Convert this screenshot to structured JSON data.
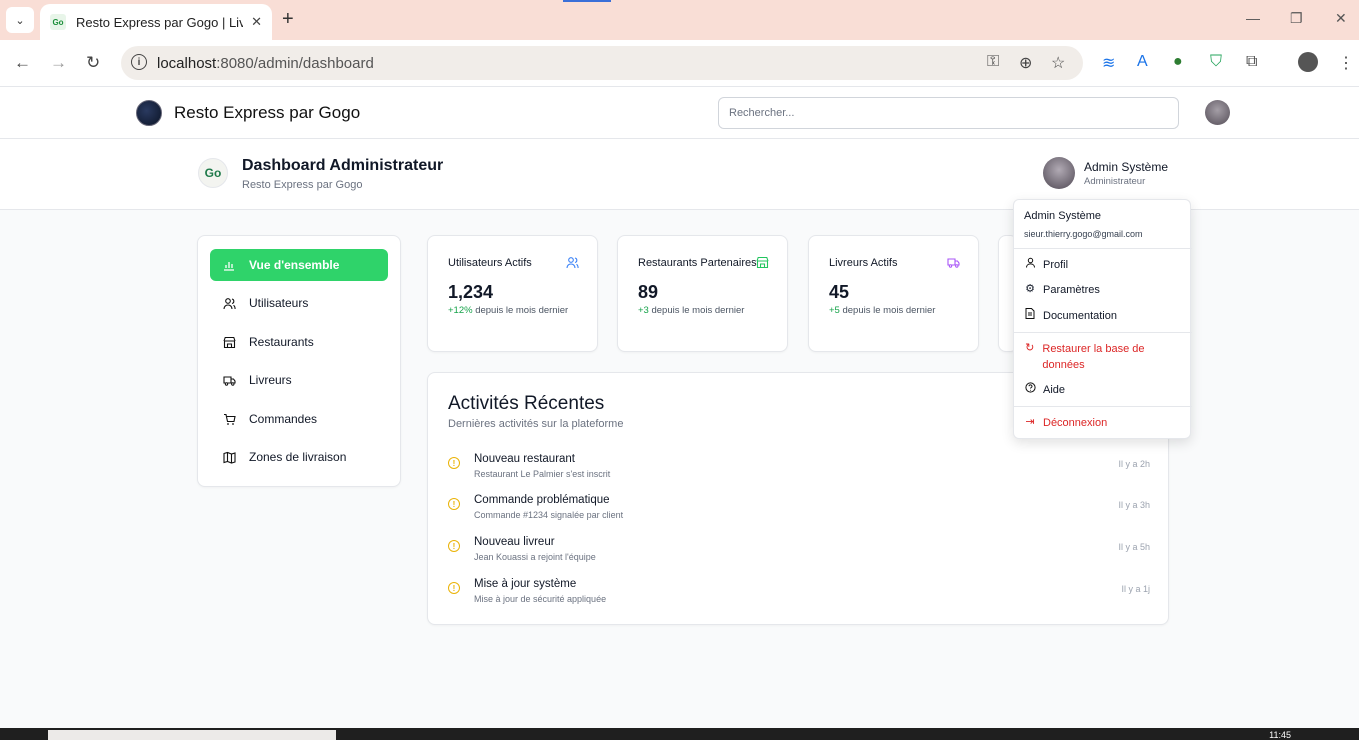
{
  "browser": {
    "tab_title": "Resto Express par Gogo | Livraison",
    "tab_favicon": "Go",
    "url_host": "localhost",
    "url_rest": ":8080/admin/dashboard",
    "new_tab": "+",
    "close": "✕",
    "tabs_menu": "⌄"
  },
  "app_header": {
    "brand": "Resto Express par Gogo",
    "search_placeholder": "Rechercher..."
  },
  "page_header": {
    "logo_text": "Go",
    "title": "Dashboard Administrateur",
    "subtitle": "Resto Express par Gogo",
    "user_name": "Admin Système",
    "user_role": "Administrateur"
  },
  "sidebar": {
    "items": [
      {
        "label": "Vue d'ensemble",
        "icon": "chart-icon"
      },
      {
        "label": "Utilisateurs",
        "icon": "users-icon"
      },
      {
        "label": "Restaurants",
        "icon": "store-icon"
      },
      {
        "label": "Livreurs",
        "icon": "truck-icon"
      },
      {
        "label": "Commandes",
        "icon": "cart-icon"
      },
      {
        "label": "Zones de livraison",
        "icon": "map-icon"
      }
    ]
  },
  "stats": [
    {
      "label": "Utilisateurs Actifs",
      "value": "1,234",
      "delta": "+12%",
      "delta_text": "depuis le mois dernier",
      "icon": "users-icon",
      "color": "#3b82f6"
    },
    {
      "label": "Restaurants Partenaires",
      "value": "89",
      "delta": "+3",
      "delta_text": "depuis le mois dernier",
      "icon": "store-icon",
      "color": "#22c55e"
    },
    {
      "label": "Livreurs Actifs",
      "value": "45",
      "delta": "+5",
      "delta_text": "depuis le mois dernier",
      "icon": "truck-icon",
      "color": "#a855f7"
    }
  ],
  "activities": {
    "title": "Activités Récentes",
    "subtitle": "Dernières activités sur la plateforme",
    "items": [
      {
        "name": "Nouveau restaurant",
        "desc": "Restaurant Le Palmier s'est inscrit",
        "time": "Il y a 2h"
      },
      {
        "name": "Commande problématique",
        "desc": "Commande #1234 signalée par client",
        "time": "Il y a 3h"
      },
      {
        "name": "Nouveau livreur",
        "desc": "Jean Kouassi a rejoint l'équipe",
        "time": "Il y a 5h"
      },
      {
        "name": "Mise à jour système",
        "desc": "Mise à jour de sécurité appliquée",
        "time": "Il y a 1j"
      }
    ]
  },
  "dropdown": {
    "name": "Admin Système",
    "email": "sieur.thierry.gogo@gmail.com",
    "items": [
      {
        "label": "Profil",
        "icon": "user-icon"
      },
      {
        "label": "Paramètres",
        "icon": "gear-icon"
      },
      {
        "label": "Documentation",
        "icon": "document-icon"
      },
      {
        "label": "Restaurer la base de données",
        "icon": "refresh-icon"
      },
      {
        "label": "Aide",
        "icon": "help-icon"
      },
      {
        "label": "Déconnexion",
        "icon": "logout-icon"
      }
    ]
  },
  "taskbar": {
    "clock": "11:45"
  },
  "colors": {
    "accent": "#2fd36a",
    "danger": "#dc2626",
    "warning": "#eab308"
  }
}
